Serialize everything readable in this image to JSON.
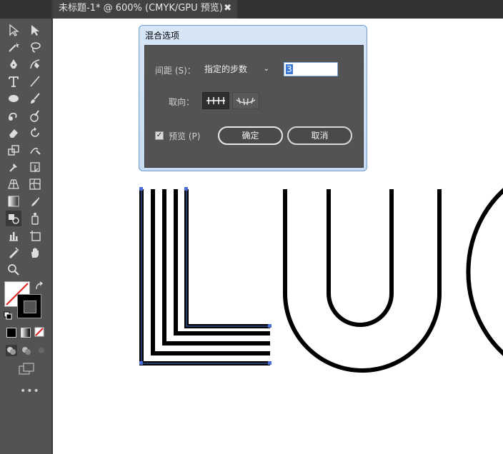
{
  "document_tab": {
    "title": "未标题-1* @ 600% (CMYK/GPU 预览)",
    "close_glyph": "✖"
  },
  "toolbar": {
    "tools": [
      [
        "selection-tool",
        "direct-selection-tool"
      ],
      [
        "magic-wand-tool",
        "lasso-tool"
      ],
      [
        "pen-tool",
        "curvature-tool"
      ],
      [
        "type-tool",
        "line-segment-tool"
      ],
      [
        "ellipse-tool",
        "paintbrush-tool"
      ],
      [
        "shaper-tool",
        "blob-brush-tool"
      ],
      [
        "eraser-tool",
        "rotate-tool"
      ],
      [
        "scale-tool",
        "warp-tool"
      ],
      [
        "puppet-warp-tool",
        "free-transform-tool"
      ],
      [
        "perspective-grid-tool",
        "mesh-tool"
      ],
      [
        "gradient-tool",
        "eyedropper-tool"
      ],
      [
        "blend-tool",
        "symbol-sprayer-tool"
      ],
      [
        "column-graph-tool",
        "artboard-tool"
      ],
      [
        "slice-tool",
        "hand-tool"
      ],
      [
        "zoom-tool"
      ]
    ],
    "more_label": "•••"
  },
  "dialog": {
    "title": "混合选项",
    "spacing_label": "间距 (S)：",
    "spacing_value": "指定的步数",
    "spacing_chevron": "⌄",
    "steps_value": "3",
    "orientation_label": "取向：",
    "preview_label": "预览 (P)",
    "preview_checked": "✓",
    "ok_label": "确定",
    "cancel_label": "取消"
  },
  "artwork": {
    "letters": "LUC"
  },
  "colors": {
    "selection_blue": "#4a6fd6",
    "toolbar_bg": "#535353",
    "dialog_frame": "#c7dbf2"
  }
}
